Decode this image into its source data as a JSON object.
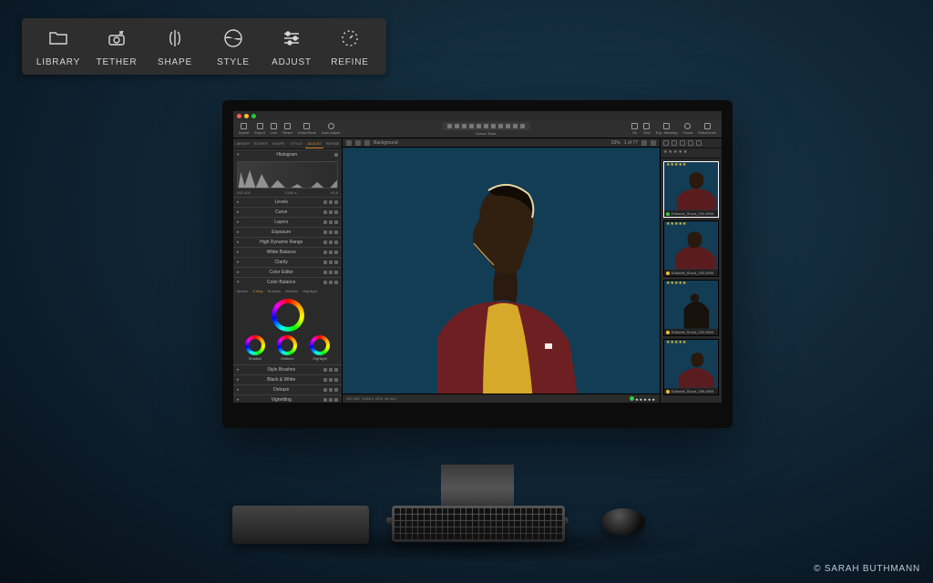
{
  "credit": "© SARAH BUTHMANN",
  "callout": {
    "items": [
      {
        "icon": "folder-icon",
        "label": "LIBRARY"
      },
      {
        "icon": "camera-tether-icon",
        "label": "TETHER"
      },
      {
        "icon": "mirror-shape-icon",
        "label": "SHAPE"
      },
      {
        "icon": "style-swirl-icon",
        "label": "STYLE"
      },
      {
        "icon": "sliders-icon",
        "label": "ADJUST"
      },
      {
        "icon": "refine-dots-icon",
        "label": "REFINE"
      }
    ]
  },
  "toolbar": {
    "left": [
      {
        "icon": "import-icon",
        "label": "Import"
      },
      {
        "icon": "export-icon",
        "label": "Export"
      },
      {
        "icon": "tether-icon",
        "label": "Live"
      },
      {
        "icon": "reset-icon",
        "label": "Reset"
      },
      {
        "icon": "undo-redo-icon",
        "label": "Undo/Redo"
      },
      {
        "icon": "auto-icon",
        "label": "Auto Adjust"
      }
    ],
    "center_label": "Cursor Tools",
    "right": [
      {
        "icon": "grid-icon",
        "label": "On"
      },
      {
        "icon": "grid2-icon",
        "label": "Grid"
      },
      {
        "icon": "warning-icon",
        "label": "Exp. Warning"
      },
      {
        "icon": "focus-icon",
        "label": "Focus"
      },
      {
        "icon": "edit-icon",
        "label": "Edits/Undo"
      }
    ]
  },
  "tool_tabs": [
    "LIBRARY",
    "TETHER",
    "SHAPE",
    "STYLE",
    "ADJUST",
    "REFINE"
  ],
  "tool_tabs_active": 4,
  "histogram": {
    "title": "Histogram",
    "iso": "ISO 400",
    "shutter": "1/160 s",
    "aperture": "f/5.6"
  },
  "adjust_sections": [
    "Levels",
    "Curve",
    "Layers",
    "Exposure",
    "High Dynamic Range",
    "White Balance",
    "Clarity",
    "Color Editor",
    "Color Balance"
  ],
  "color_balance": {
    "tabs": [
      "Master",
      "3-Way",
      "Shadow",
      "Midtone",
      "Highlight"
    ],
    "active": 1,
    "labels": {
      "shadow": "Shadow",
      "midtone": "Midtone",
      "highlight": "Highlight"
    }
  },
  "extra_sections": [
    "Style Brushes",
    "Black & White",
    "Dehaze",
    "Vignetting"
  ],
  "viewer": {
    "layer_label": "Background",
    "zoom": "33%",
    "counter": "1 of 77",
    "footer": {
      "iso": "ISO 400",
      "shutter": "1/160 s",
      "aperture": "f/5.6",
      "lens": "64 mm",
      "rating": "★★★★★"
    }
  },
  "browser": {
    "star_filter": "★★★★★",
    "thumbs": [
      {
        "name": "Editorial_Shoot_292.ARW",
        "rating": "★★★★★",
        "tag": "green",
        "selected": true
      },
      {
        "name": "Editorial_Shoot_293.ARW",
        "rating": "★★★★★",
        "tag": "yellow",
        "selected": false
      },
      {
        "name": "Editorial_Shoot_294.ARW",
        "rating": "★★★★★",
        "tag": "yellow",
        "selected": false
      },
      {
        "name": "Editorial_Shoot_295.ARW",
        "rating": "★★★★★",
        "tag": "yellow",
        "selected": false
      }
    ]
  }
}
